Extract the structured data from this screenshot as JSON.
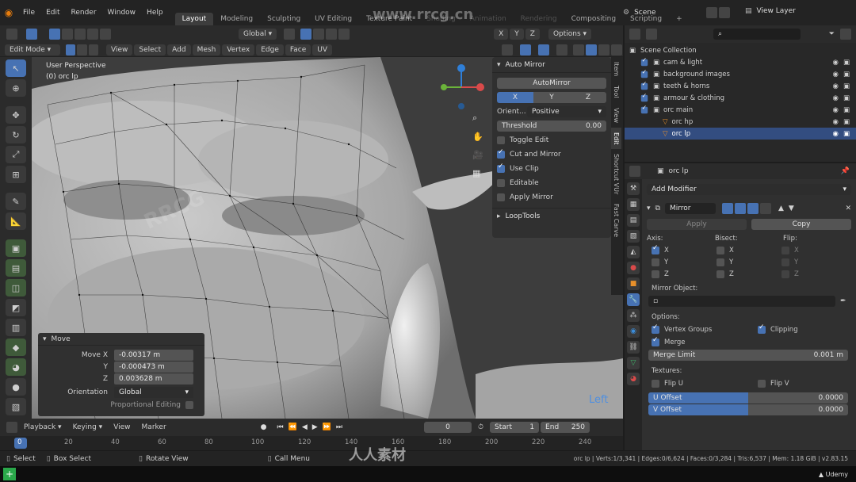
{
  "topbar": {
    "menus": [
      "File",
      "Edit",
      "Render",
      "Window",
      "Help"
    ],
    "workspaces": [
      "Layout",
      "Modeling",
      "Sculpting",
      "UV Editing",
      "Texture Paint",
      "Shading",
      "Animation",
      "Rendering",
      "Compositing",
      "Scripting"
    ],
    "active_workspace": "Layout",
    "add_tab": "+",
    "scene": "Scene",
    "view_layer": "View Layer"
  },
  "vp_header": {
    "transform_orientation": "Global",
    "axis_x": "X",
    "axis_y": "Y",
    "axis_z": "Z",
    "options": "Options",
    "mode": "Edit Mode",
    "menus": [
      "View",
      "Select",
      "Add",
      "Mesh",
      "Vertex",
      "Edge",
      "Face",
      "UV"
    ]
  },
  "viewport": {
    "perspective_label": "User Perspective",
    "object_label": "(0) orc lp",
    "view_label": "Left",
    "gizmo_x": "X",
    "gizmo_y": "Y",
    "gizmo_z": "Z"
  },
  "npanel": {
    "section_title": "Auto Mirror",
    "automirror_button": "AutoMirror",
    "axes": [
      "X",
      "Y",
      "Z"
    ],
    "orient_label": "Orient...",
    "orient_value": "Positive",
    "threshold_label": "Threshold",
    "threshold_value": "0.00",
    "options": [
      {
        "label": "Toggle Edit",
        "checked": false
      },
      {
        "label": "Cut and Mirror",
        "checked": true
      },
      {
        "label": "Use Clip",
        "checked": true
      },
      {
        "label": "Editable",
        "checked": false
      },
      {
        "label": "Apply Mirror",
        "checked": false
      }
    ],
    "looptools": "LoopTools",
    "tabs": [
      "Item",
      "Tool",
      "View",
      "Edit",
      "Shortcut VUr",
      "Fast Carve"
    ],
    "active_tab": "Edit"
  },
  "oppanel": {
    "title": "Move",
    "move_x_label": "Move X",
    "move_x": "-0.00317 m",
    "y_label": "Y",
    "y": "-0.000473 m",
    "z_label": "Z",
    "z": "0.003628 m",
    "orientation_label": "Orientation",
    "orientation": "Global",
    "proportional_label": "Proportional Editing"
  },
  "timeline": {
    "playback": "Playback",
    "keying": "Keying",
    "view": "View",
    "marker": "Marker",
    "current_frame": "0",
    "start_label": "Start",
    "start": "1",
    "end_label": "End",
    "end": "250",
    "ticks": [
      "0",
      "20",
      "40",
      "60",
      "80",
      "100",
      "120",
      "140",
      "160",
      "180",
      "200",
      "220",
      "240"
    ]
  },
  "statusbar": {
    "select": "Select",
    "box_select": "Box Select",
    "rotate_view": "Rotate View",
    "call_menu": "Call Menu",
    "stats": "orc lp | Verts:1/3,341 | Edges:0/6,624 | Faces:0/3,284 | Tris:6,537 | Mem: 1.18 GiB | v2.83.15"
  },
  "outliner": {
    "root": "Scene Collection",
    "items": [
      {
        "label": "cam & light",
        "indent": 1,
        "selected": false
      },
      {
        "label": "background images",
        "indent": 1,
        "selected": false
      },
      {
        "label": "teeth & horns",
        "indent": 1,
        "selected": false
      },
      {
        "label": "armour & clothing",
        "indent": 1,
        "selected": false
      },
      {
        "label": "orc main",
        "indent": 1,
        "selected": false
      },
      {
        "label": "orc hp",
        "indent": 2,
        "selected": false
      },
      {
        "label": "orc lp",
        "indent": 2,
        "selected": true
      }
    ]
  },
  "props": {
    "object_name": "orc lp",
    "add_modifier": "Add Modifier",
    "modifier_name": "Mirror",
    "apply": "Apply",
    "copy": "Copy",
    "axis_label": "Axis:",
    "bisect_label": "Bisect:",
    "flip_label": "Flip:",
    "axis_rows": [
      {
        "axis": "X",
        "axis_on": true,
        "bisect_on": false,
        "flip_on": false
      },
      {
        "axis": "Y",
        "axis_on": false,
        "bisect_on": false,
        "flip_on": false
      },
      {
        "axis": "Z",
        "axis_on": false,
        "bisect_on": false,
        "flip_on": false
      }
    ],
    "mirror_object_label": "Mirror Object:",
    "options_label": "Options:",
    "vertex_groups": "Vertex Groups",
    "clipping": "Clipping",
    "merge": "Merge",
    "merge_limit_label": "Merge Limit",
    "merge_limit": "0.001 m",
    "textures_label": "Textures:",
    "flip_u": "Flip U",
    "flip_v": "Flip V",
    "u_offset_label": "U Offset",
    "u_offset": "0.0000",
    "v_offset_label": "V Offset",
    "v_offset": "0.0000"
  },
  "watermarks": {
    "site": "www.rrcg.cn",
    "udemy": "Udemy",
    "brand": "人人素材",
    "rrcg": "RRCG"
  },
  "colors": {
    "accent": "#4772b3",
    "selected_row": "#334d80",
    "panel": "#303030",
    "background": "#1d1d1d"
  }
}
